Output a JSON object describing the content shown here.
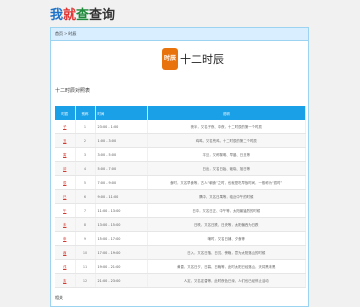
{
  "logo": {
    "c1": "我",
    "c2": "就",
    "c3": "查",
    "c4": "查询"
  },
  "breadcrumb": {
    "home": "首页",
    "sep": ">",
    "current": "时辰"
  },
  "badge": "时辰",
  "title": "十二时辰",
  "section_title": "十二时辰对照表",
  "table": {
    "headers": [
      "时辰",
      "别称",
      "时间",
      "说明"
    ],
    "rows": [
      {
        "link": "子",
        "seq": "1",
        "time": "23:00 - 1:00",
        "desc": "夜半，又名子夜、中夜，十二时辰的第一个时辰"
      },
      {
        "link": "丑",
        "seq": "2",
        "time": "1:00 - 3:00",
        "desc": "鸡鸣，又名荒鸡，十二时辰的第二个时辰"
      },
      {
        "link": "寅",
        "seq": "3",
        "time": "3:00 - 5:00",
        "desc": "平旦，又称黎明、早晨、日旦等"
      },
      {
        "link": "卯",
        "seq": "4",
        "time": "5:00 - 7:00",
        "desc": "日出，又名日始、破晓、旭日等"
      },
      {
        "link": "辰",
        "seq": "5",
        "time": "7:00 - 9:00",
        "desc": "食时，又名早食等，古人“朝食”之时，也就是吃早饭时间，一般称为“辰时”"
      },
      {
        "link": "巳",
        "seq": "6",
        "time": "9:00 - 11:00",
        "desc": "隅中，又名日禺等，临近中午的时候"
      },
      {
        "link": "午",
        "seq": "7",
        "time": "11:00 - 13:00",
        "desc": "日中，又名日正、中午等，太阳最猛烈的时候"
      },
      {
        "link": "未",
        "seq": "8",
        "time": "13:00 - 15:00",
        "desc": "日昳，又名日跌、日央等，太阳偏西为日跌"
      },
      {
        "link": "申",
        "seq": "9",
        "time": "15:00 - 17:00",
        "desc": "哺时，又名日铺、夕食等"
      },
      {
        "link": "酉",
        "seq": "10",
        "time": "17:00 - 19:00",
        "desc": "日入，又名日落、日沉、傍晚，意为太阳落山的时候"
      },
      {
        "link": "戌",
        "seq": "11",
        "time": "19:00 - 21:00",
        "desc": "黄昏，又名日夕、日暮、日晚等，此时太阳已经落山，天将黑未黑"
      },
      {
        "link": "亥",
        "seq": "12",
        "time": "21:00 - 23:00",
        "desc": "人定，又名定昏等，此时夜色已深，人们也已经停止活动"
      }
    ]
  },
  "footer_label": "相关",
  "colors": {
    "accent": "#1aa0e6",
    "badge": "#e8730c",
    "link": "#d23a2f",
    "breadcrumb_bg": "#d9efff"
  }
}
